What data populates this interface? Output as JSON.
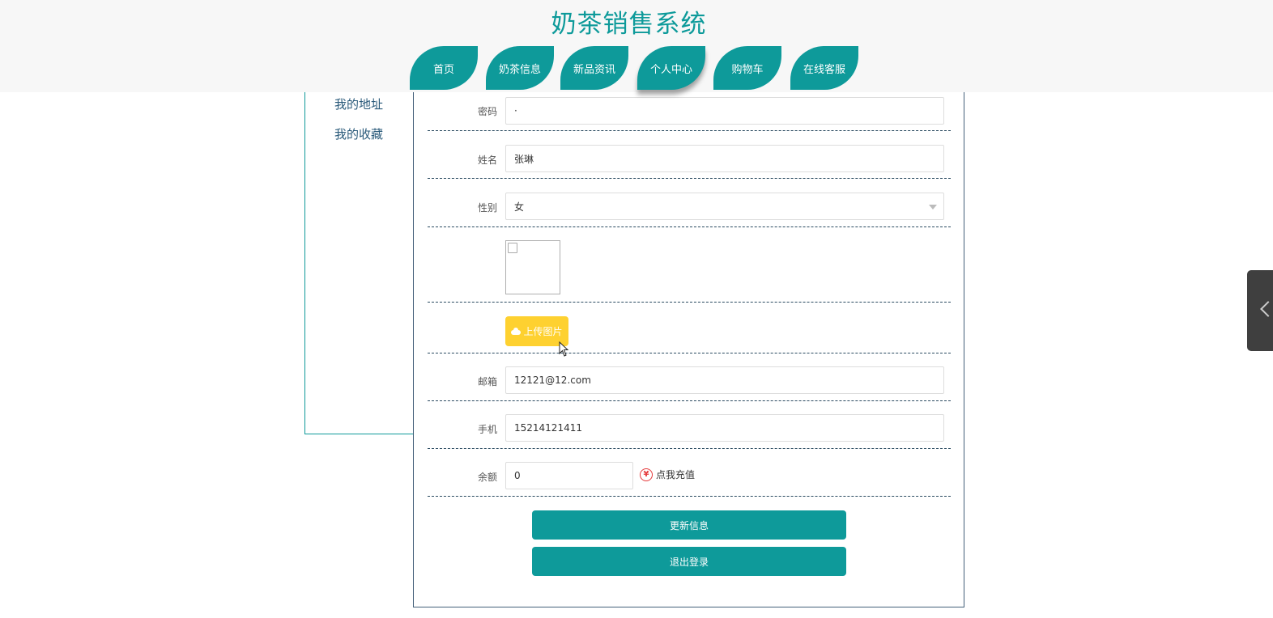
{
  "site": {
    "title": "奶茶销售系统"
  },
  "nav": {
    "tabs": [
      {
        "label": "首页",
        "active": false
      },
      {
        "label": "奶茶信息",
        "active": false
      },
      {
        "label": "新品资讯",
        "active": false
      },
      {
        "label": "个人中心",
        "active": true
      },
      {
        "label": "购物车",
        "active": false
      },
      {
        "label": "在线客服",
        "active": false
      }
    ]
  },
  "sidebar": {
    "items": [
      {
        "label": "我的地址"
      },
      {
        "label": "我的收藏"
      }
    ]
  },
  "form": {
    "password": {
      "label": "密码",
      "value": "·"
    },
    "name": {
      "label": "姓名",
      "value": "张琳"
    },
    "gender": {
      "label": "性别",
      "value": "女"
    },
    "upload_label": "上传图片",
    "email": {
      "label": "邮箱",
      "value": "12121@12.com"
    },
    "phone": {
      "label": "手机",
      "value": "15214121411"
    },
    "balance": {
      "label": "余额",
      "value": "0"
    },
    "recharge_label": "点我充值",
    "recharge_icon": "¥",
    "update_label": "更新信息",
    "logout_label": "退出登录"
  },
  "colors": {
    "accent": "#0e9a9a",
    "upload": "#fed130",
    "recharge": "#e5393b"
  }
}
